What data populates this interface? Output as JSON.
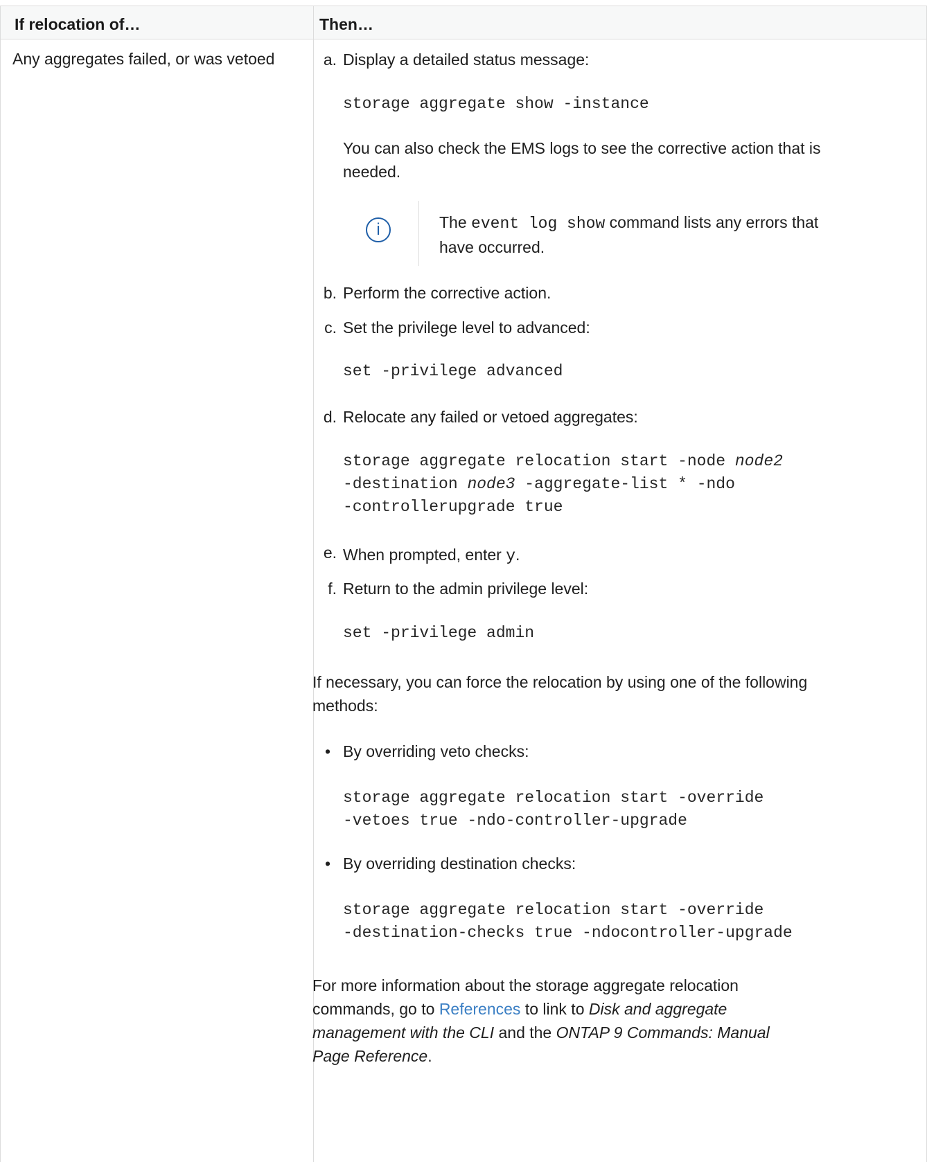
{
  "header": {
    "col1": "If relocation of…",
    "col2": "Then…"
  },
  "row": {
    "condition": "Any aggregates failed, or was vetoed"
  },
  "steps": {
    "a_marker": "a.",
    "a_text": "Display a detailed status message:",
    "a_code": "storage aggregate show -instance",
    "a_para": "You can also check the EMS logs to see the corrective action that is needed.",
    "note_before": "The ",
    "note_code": "event log show",
    "note_after": " command lists any errors that have occurred.",
    "b_marker": "b.",
    "b_text": "Perform the corrective action.",
    "c_marker": "c.",
    "c_text": "Set the privilege level to advanced:",
    "c_code": "set -privilege advanced",
    "d_marker": "d.",
    "d_text": "Relocate any failed or vetoed aggregates:",
    "d_code_1a": "storage aggregate relocation start -node ",
    "d_code_1b": "node2",
    "d_code_2a": "-destination ",
    "d_code_2b": "node3",
    "d_code_2c": " -aggregate-list * -ndo",
    "d_code_3": "-controllerupgrade true",
    "e_marker": "e.",
    "e_text": "When prompted, enter ",
    "e_code": "y",
    "e_end": ".",
    "f_marker": "f.",
    "f_text": "Return to the admin privilege level:",
    "f_code": "set -privilege admin"
  },
  "force": {
    "intro": "If necessary, you can force the relocation by using one of the following methods:",
    "bullet1": "By overriding veto checks:",
    "bullet1_code_1": "storage aggregate relocation start -override",
    "bullet1_code_2": "-vetoes true -ndo-controller-upgrade",
    "bullet2": "By overriding destination checks:",
    "bullet2_code_1": "storage aggregate relocation start -override",
    "bullet2_code_2": "-destination-checks true -ndocontroller-upgrade"
  },
  "more": {
    "p1": "For more information about the storage aggregate relocation",
    "p2a": "commands, go to ",
    "link": "References",
    "p2b": " to link to ",
    "p2c": "Disk and aggregate",
    "p3a": "management with the CLI",
    "p3b": " and the ",
    "p3c": "ONTAP 9 Commands: Manual",
    "p4a": "Page Reference",
    "p4b": "."
  },
  "colors": {
    "link": "#3b7fc4",
    "icon": "#1f5fa8",
    "header_bg": "#f7f8f8",
    "border": "#dcdcdc"
  },
  "icons": {
    "note": "info-circle-icon",
    "bullet": "bullet"
  }
}
